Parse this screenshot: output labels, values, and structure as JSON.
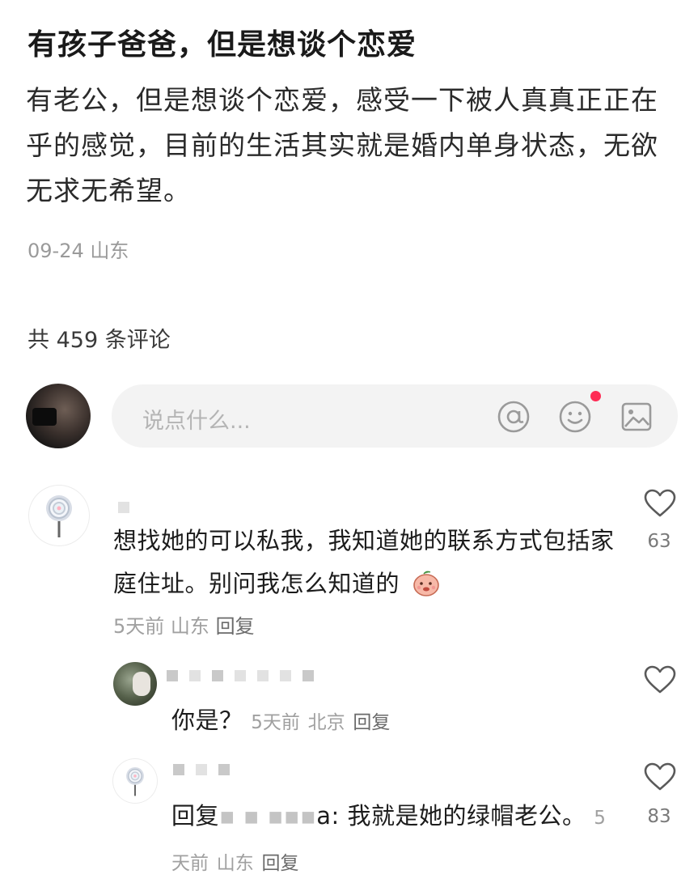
{
  "post": {
    "title": "有孩子爸爸，但是想谈个恋爱",
    "body": "有老公，但是想谈个恋爱，感受一下被人真真正正在乎的感觉，目前的生活其实就是婚内单身状态，无欲无求无希望。",
    "date": "09-24",
    "location": "山东"
  },
  "comments_header": {
    "count_label": "共 459 条评论"
  },
  "input": {
    "placeholder": "说点什么...",
    "icons": [
      "at-icon",
      "emoji-icon",
      "image-icon"
    ]
  },
  "comments": [
    {
      "text": "想找她的可以私我，我知道她的联系方式包括家庭住址。别问我怎么知道的",
      "time": "5天前",
      "location": "山东",
      "reply_label": "回复",
      "likes": "63"
    },
    {
      "text": "你是？",
      "time": "5天前",
      "location": "北京",
      "reply_label": "回复",
      "likes": ""
    },
    {
      "reply_prefix": "回复",
      "reply_target_tail": "a:",
      "text": " 我就是她的绿帽老公。",
      "time": "5天前",
      "location": "山东",
      "reply_label": "回复",
      "likes": "83"
    }
  ],
  "colors": {
    "accent_red": "#fe2c55",
    "meta_gray": "#9a9a9a",
    "input_bg": "#f3f3f3"
  }
}
